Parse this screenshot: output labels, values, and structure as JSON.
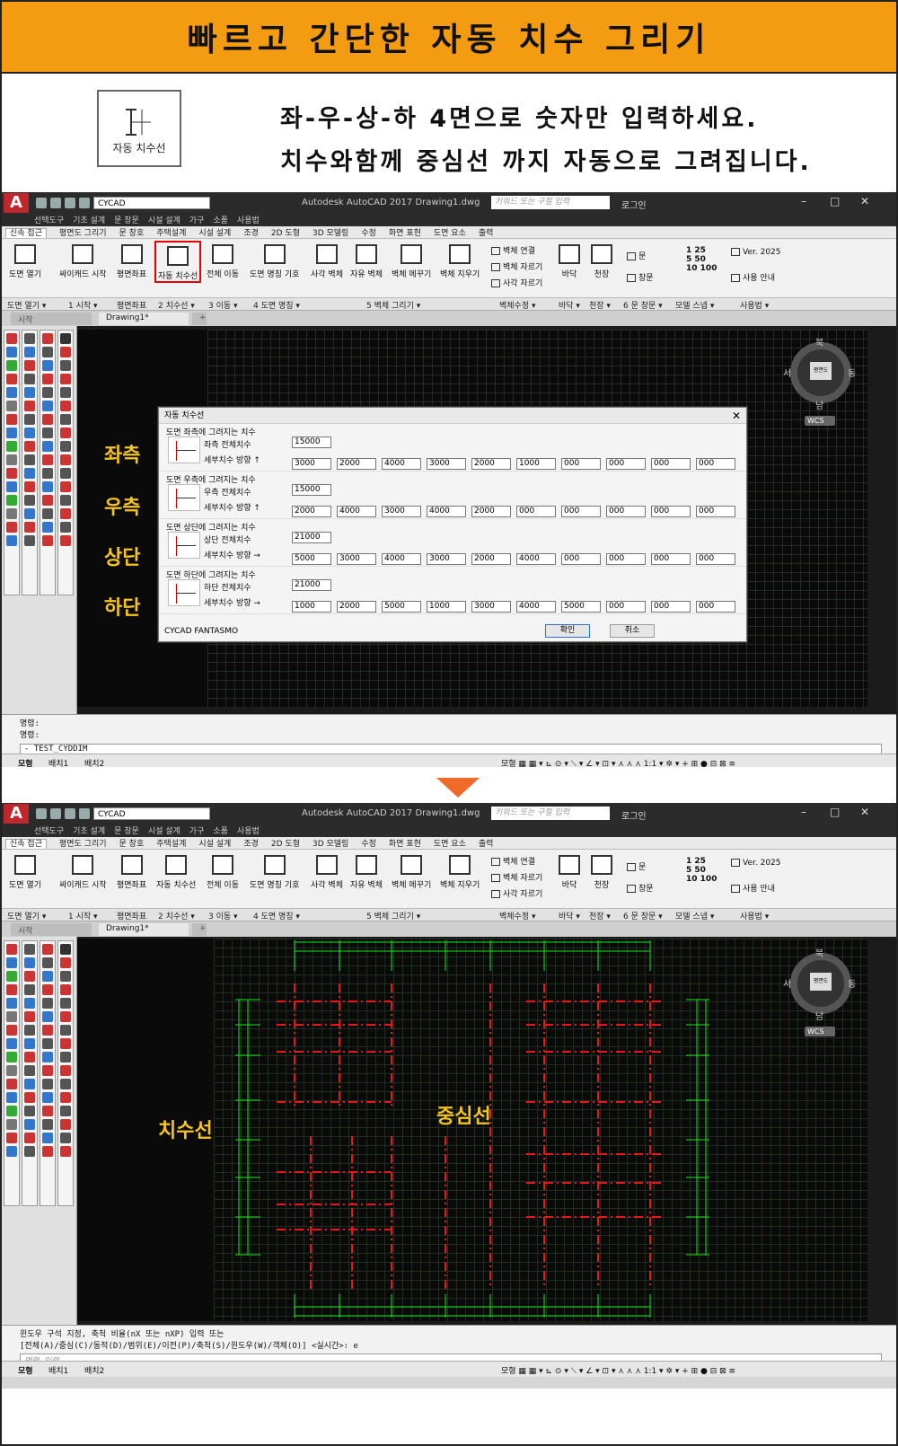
{
  "banner": {
    "title": "빠르고 간단한 자동 치수 그리기"
  },
  "intro": {
    "icon_label": "자동 치수선",
    "line1": "좌-우-상-하 4면으로 숫자만 입력하세요.",
    "line2": "치수와함께 중심선 까지 자동으로 그려집니다."
  },
  "app": {
    "workspace": "CYCAD",
    "title": "Autodesk AutoCAD 2017    Drawing1.dwg",
    "search_placeholder": "키워드 또는 구절 입력",
    "login": "로그인",
    "menu": [
      "선택도구",
      "기초 설계",
      "문 창문",
      "시설 설계",
      "가구",
      "소품",
      "사용법"
    ],
    "tabs": [
      "신속 접근",
      "평면도 그리기",
      "문 창호",
      "주택설계",
      "시설 설계",
      "조경",
      "2D 도형",
      "3D 모델링",
      "수정",
      "화면 표현",
      "도면 요소",
      "출력"
    ],
    "ribbon_buttons": [
      "도면 열기",
      "싸이캐드 시작",
      "평면좌표",
      "자동 치수선",
      "전체 이동",
      "도면 명칭 기호",
      "사각 벽체",
      "자유 벽체",
      "벽체 메꾸기",
      "벽체 지우기"
    ],
    "wall_tools": [
      "벽체 연결",
      "벽체 자르기",
      "사각 자르기"
    ],
    "ribbon_right": [
      "바닥",
      "천장",
      "문",
      "창문"
    ],
    "scale_labels": [
      "1",
      "25",
      "5",
      "50",
      "10",
      "100"
    ],
    "version": "Ver. 2025",
    "guide": "사용 안내",
    "groups": [
      "도면 열기 ▾",
      "1 시작 ▾",
      "평면좌표",
      "2 치수선 ▾",
      "3 이동 ▾",
      "4 도면 명칭 ▾",
      "5 벽체 그리기 ▾",
      "벽체수정 ▾",
      "바닥 ▾",
      "천장 ▾",
      "6 문 창문 ▾",
      "모델 스넵 ▾",
      "사용법 ▾"
    ],
    "doc_tabs": [
      "시작",
      "Drawing1*"
    ],
    "compass": {
      "n": "북",
      "s": "남",
      "w": "서",
      "e": "동",
      "cube": "평면도",
      "wcs": "WCS"
    },
    "layout_tabs": [
      "모형",
      "배치1",
      "배치2"
    ],
    "status_right": "모형  ▦ ▦ ▾  ⊾ ⊙ ▾ ⟍ ▾ ∠ ▾ ⊡ ▾ ⋏ ⋏ ⋏ 1:1 ▾ ✲ ▾ + ⊞ ● ⊟ ⊠ ≡"
  },
  "screen1": {
    "annotations": [
      "좌측",
      "우측",
      "상단",
      "하단"
    ],
    "command_lines": [
      "명령:",
      "명령:"
    ],
    "command_input": "- TEST_CYDDIM",
    "dialog": {
      "title": "자동 치수선",
      "sections": [
        {
          "title": "도면 좌측에 그려지는 치수",
          "total_label": "좌측 전체치수",
          "total": "15000",
          "detail_label": "세부치수 방향 ↑",
          "values": [
            "3000",
            "2000",
            "4000",
            "3000",
            "2000",
            "1000",
            "000",
            "000",
            "000",
            "000"
          ]
        },
        {
          "title": "도면 우측에 그려지는 치수",
          "total_label": "우측 전체치수",
          "total": "15000",
          "detail_label": "세부치수 방향 ↑",
          "values": [
            "2000",
            "4000",
            "3000",
            "4000",
            "2000",
            "000",
            "000",
            "000",
            "000",
            "000"
          ]
        },
        {
          "title": "도면 상단에 그려지는 치수",
          "total_label": "상단 전체치수",
          "total": "21000",
          "detail_label": "세부치수 방향 →",
          "values": [
            "5000",
            "3000",
            "4000",
            "3000",
            "2000",
            "4000",
            "000",
            "000",
            "000",
            "000"
          ]
        },
        {
          "title": "도면 하단에 그려지는 치수",
          "total_label": "하단 전체치수",
          "total": "21000",
          "detail_label": "세부치수 방향 →",
          "values": [
            "1000",
            "2000",
            "5000",
            "1000",
            "3000",
            "4000",
            "5000",
            "000",
            "000",
            "000"
          ]
        }
      ],
      "footer": "CYCAD FANTASMO",
      "ok": "확인",
      "cancel": "취소"
    }
  },
  "screen2": {
    "annotations": [
      "치수선",
      "중심선"
    ],
    "command_lines": [
      "윈도우 구석 지정, 축척 비율(nX 또는 nXP) 입력 또는",
      "[전체(A)/중심(C)/동적(D)/범위(E)/이전(P)/축척(S)/윈도우(W)/객체(O)] <실시간>: e"
    ],
    "command_input": "명령 입력"
  },
  "colors": {
    "banner": "#f39c12",
    "dimension": "#19e619",
    "centerline": "#e81818",
    "annotation": "#f5c518",
    "highlight": "#e30000"
  }
}
